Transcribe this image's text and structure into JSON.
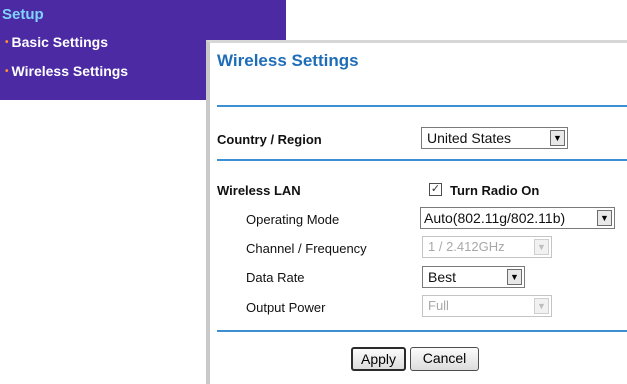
{
  "menu": {
    "title": "Setup",
    "items": [
      {
        "label": "Basic Settings"
      },
      {
        "label": "Wireless Settings"
      }
    ]
  },
  "panel": {
    "title": "Wireless Settings",
    "country_label": "Country / Region",
    "country_value": "United States",
    "wireless_lan_label": "Wireless LAN",
    "radio_checkbox_label": "Turn Radio On",
    "radio_checked": true,
    "operating_mode_label": "Operating Mode",
    "operating_mode_value": "Auto(802.11g/802.11b)",
    "channel_label": "Channel / Frequency",
    "channel_value": "1 / 2.412GHz",
    "data_rate_label": "Data Rate",
    "data_rate_value": "Best",
    "output_power_label": "Output Power",
    "output_power_value": "Full",
    "apply_label": "Apply",
    "cancel_label": "Cancel"
  },
  "colors": {
    "menu_bg": "#4b2aa3",
    "menu_title": "#7fd4ff",
    "title_blue": "#1f6db8",
    "rule_blue": "#3b8fd2",
    "bullet_orange": "#ff8c3a"
  },
  "icons": {
    "dropdown": "chevron-down-icon",
    "checkbox": "check-icon"
  }
}
